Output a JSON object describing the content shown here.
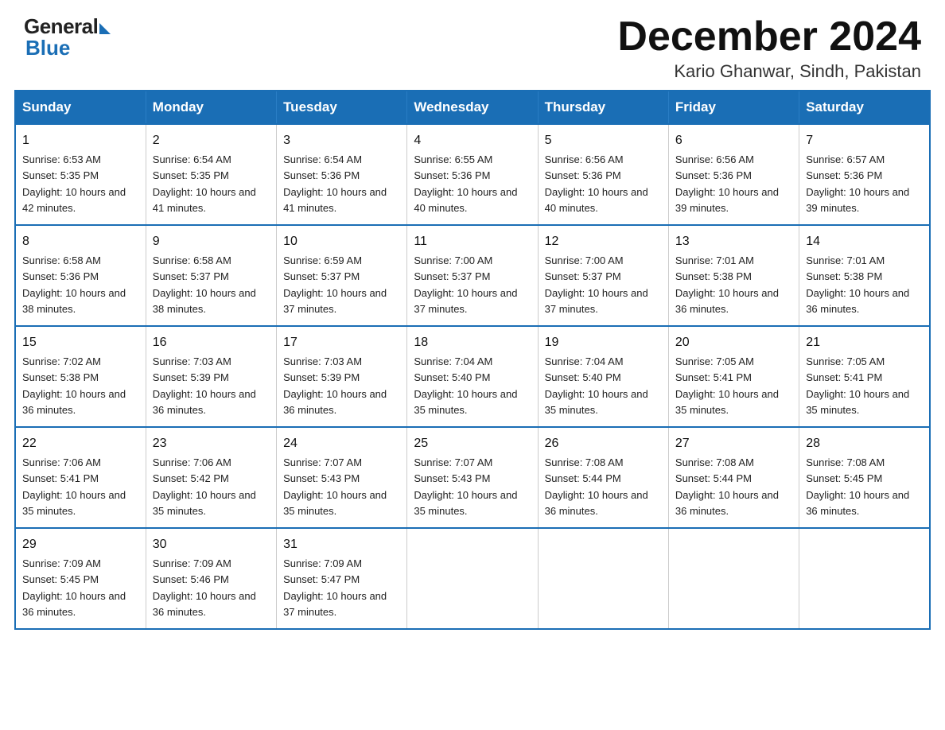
{
  "logo": {
    "general": "General",
    "blue": "Blue"
  },
  "header": {
    "month_year": "December 2024",
    "location": "Kario Ghanwar, Sindh, Pakistan"
  },
  "days_of_week": [
    "Sunday",
    "Monday",
    "Tuesday",
    "Wednesday",
    "Thursday",
    "Friday",
    "Saturday"
  ],
  "weeks": [
    [
      {
        "day": "1",
        "sunrise": "6:53 AM",
        "sunset": "5:35 PM",
        "daylight": "10 hours and 42 minutes."
      },
      {
        "day": "2",
        "sunrise": "6:54 AM",
        "sunset": "5:35 PM",
        "daylight": "10 hours and 41 minutes."
      },
      {
        "day": "3",
        "sunrise": "6:54 AM",
        "sunset": "5:36 PM",
        "daylight": "10 hours and 41 minutes."
      },
      {
        "day": "4",
        "sunrise": "6:55 AM",
        "sunset": "5:36 PM",
        "daylight": "10 hours and 40 minutes."
      },
      {
        "day": "5",
        "sunrise": "6:56 AM",
        "sunset": "5:36 PM",
        "daylight": "10 hours and 40 minutes."
      },
      {
        "day": "6",
        "sunrise": "6:56 AM",
        "sunset": "5:36 PM",
        "daylight": "10 hours and 39 minutes."
      },
      {
        "day": "7",
        "sunrise": "6:57 AM",
        "sunset": "5:36 PM",
        "daylight": "10 hours and 39 minutes."
      }
    ],
    [
      {
        "day": "8",
        "sunrise": "6:58 AM",
        "sunset": "5:36 PM",
        "daylight": "10 hours and 38 minutes."
      },
      {
        "day": "9",
        "sunrise": "6:58 AM",
        "sunset": "5:37 PM",
        "daylight": "10 hours and 38 minutes."
      },
      {
        "day": "10",
        "sunrise": "6:59 AM",
        "sunset": "5:37 PM",
        "daylight": "10 hours and 37 minutes."
      },
      {
        "day": "11",
        "sunrise": "7:00 AM",
        "sunset": "5:37 PM",
        "daylight": "10 hours and 37 minutes."
      },
      {
        "day": "12",
        "sunrise": "7:00 AM",
        "sunset": "5:37 PM",
        "daylight": "10 hours and 37 minutes."
      },
      {
        "day": "13",
        "sunrise": "7:01 AM",
        "sunset": "5:38 PM",
        "daylight": "10 hours and 36 minutes."
      },
      {
        "day": "14",
        "sunrise": "7:01 AM",
        "sunset": "5:38 PM",
        "daylight": "10 hours and 36 minutes."
      }
    ],
    [
      {
        "day": "15",
        "sunrise": "7:02 AM",
        "sunset": "5:38 PM",
        "daylight": "10 hours and 36 minutes."
      },
      {
        "day": "16",
        "sunrise": "7:03 AM",
        "sunset": "5:39 PM",
        "daylight": "10 hours and 36 minutes."
      },
      {
        "day": "17",
        "sunrise": "7:03 AM",
        "sunset": "5:39 PM",
        "daylight": "10 hours and 36 minutes."
      },
      {
        "day": "18",
        "sunrise": "7:04 AM",
        "sunset": "5:40 PM",
        "daylight": "10 hours and 35 minutes."
      },
      {
        "day": "19",
        "sunrise": "7:04 AM",
        "sunset": "5:40 PM",
        "daylight": "10 hours and 35 minutes."
      },
      {
        "day": "20",
        "sunrise": "7:05 AM",
        "sunset": "5:41 PM",
        "daylight": "10 hours and 35 minutes."
      },
      {
        "day": "21",
        "sunrise": "7:05 AM",
        "sunset": "5:41 PM",
        "daylight": "10 hours and 35 minutes."
      }
    ],
    [
      {
        "day": "22",
        "sunrise": "7:06 AM",
        "sunset": "5:41 PM",
        "daylight": "10 hours and 35 minutes."
      },
      {
        "day": "23",
        "sunrise": "7:06 AM",
        "sunset": "5:42 PM",
        "daylight": "10 hours and 35 minutes."
      },
      {
        "day": "24",
        "sunrise": "7:07 AM",
        "sunset": "5:43 PM",
        "daylight": "10 hours and 35 minutes."
      },
      {
        "day": "25",
        "sunrise": "7:07 AM",
        "sunset": "5:43 PM",
        "daylight": "10 hours and 35 minutes."
      },
      {
        "day": "26",
        "sunrise": "7:08 AM",
        "sunset": "5:44 PM",
        "daylight": "10 hours and 36 minutes."
      },
      {
        "day": "27",
        "sunrise": "7:08 AM",
        "sunset": "5:44 PM",
        "daylight": "10 hours and 36 minutes."
      },
      {
        "day": "28",
        "sunrise": "7:08 AM",
        "sunset": "5:45 PM",
        "daylight": "10 hours and 36 minutes."
      }
    ],
    [
      {
        "day": "29",
        "sunrise": "7:09 AM",
        "sunset": "5:45 PM",
        "daylight": "10 hours and 36 minutes."
      },
      {
        "day": "30",
        "sunrise": "7:09 AM",
        "sunset": "5:46 PM",
        "daylight": "10 hours and 36 minutes."
      },
      {
        "day": "31",
        "sunrise": "7:09 AM",
        "sunset": "5:47 PM",
        "daylight": "10 hours and 37 minutes."
      },
      null,
      null,
      null,
      null
    ]
  ]
}
